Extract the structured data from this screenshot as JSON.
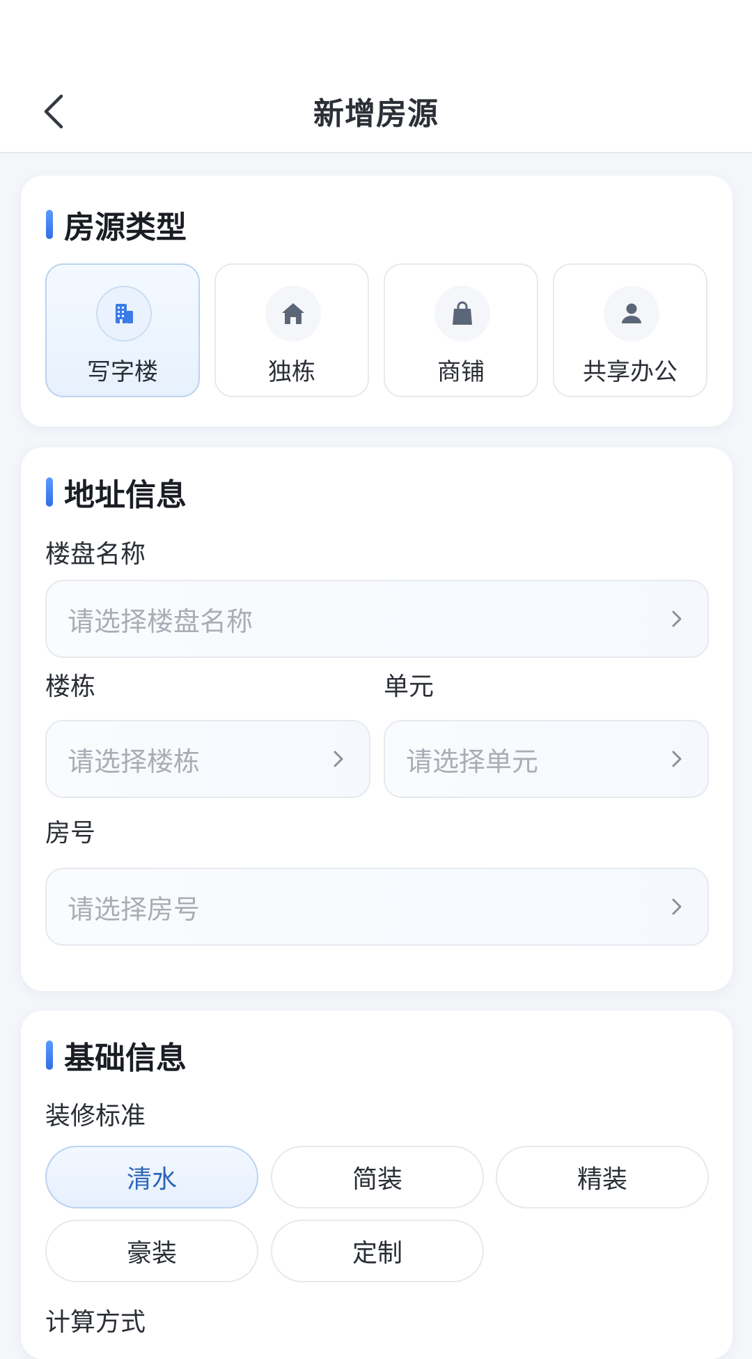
{
  "header": {
    "title": "新增房源",
    "back_icon": "chevron-left-icon"
  },
  "property_type": {
    "title": "房源类型",
    "options": [
      {
        "label": "写字楼",
        "icon": "office-building-icon",
        "selected": true
      },
      {
        "label": "独栋",
        "icon": "house-icon",
        "selected": false
      },
      {
        "label": "商铺",
        "icon": "shopping-bag-icon",
        "selected": false
      },
      {
        "label": "共享办公",
        "icon": "person-icon",
        "selected": false
      }
    ]
  },
  "address": {
    "title": "地址信息",
    "building_name": {
      "label": "楼盘名称",
      "placeholder": "请选择楼盘名称"
    },
    "block": {
      "label": "楼栋",
      "placeholder": "请选择楼栋"
    },
    "unit": {
      "label": "单元",
      "placeholder": "请选择单元"
    },
    "room": {
      "label": "房号",
      "placeholder": "请选择房号"
    }
  },
  "basic": {
    "title": "基础信息",
    "decoration": {
      "label": "装修标准",
      "options": [
        {
          "label": "清水",
          "selected": true
        },
        {
          "label": "简装",
          "selected": false
        },
        {
          "label": "精装",
          "selected": false
        },
        {
          "label": "豪装",
          "selected": false
        },
        {
          "label": "定制",
          "selected": false
        }
      ]
    },
    "calc_method": {
      "label": "计算方式"
    }
  },
  "colors": {
    "accent": "#2f6fe4",
    "selected_text": "#2d66b8",
    "icon_gray": "#5b6678",
    "placeholder": "#a8adb6"
  }
}
